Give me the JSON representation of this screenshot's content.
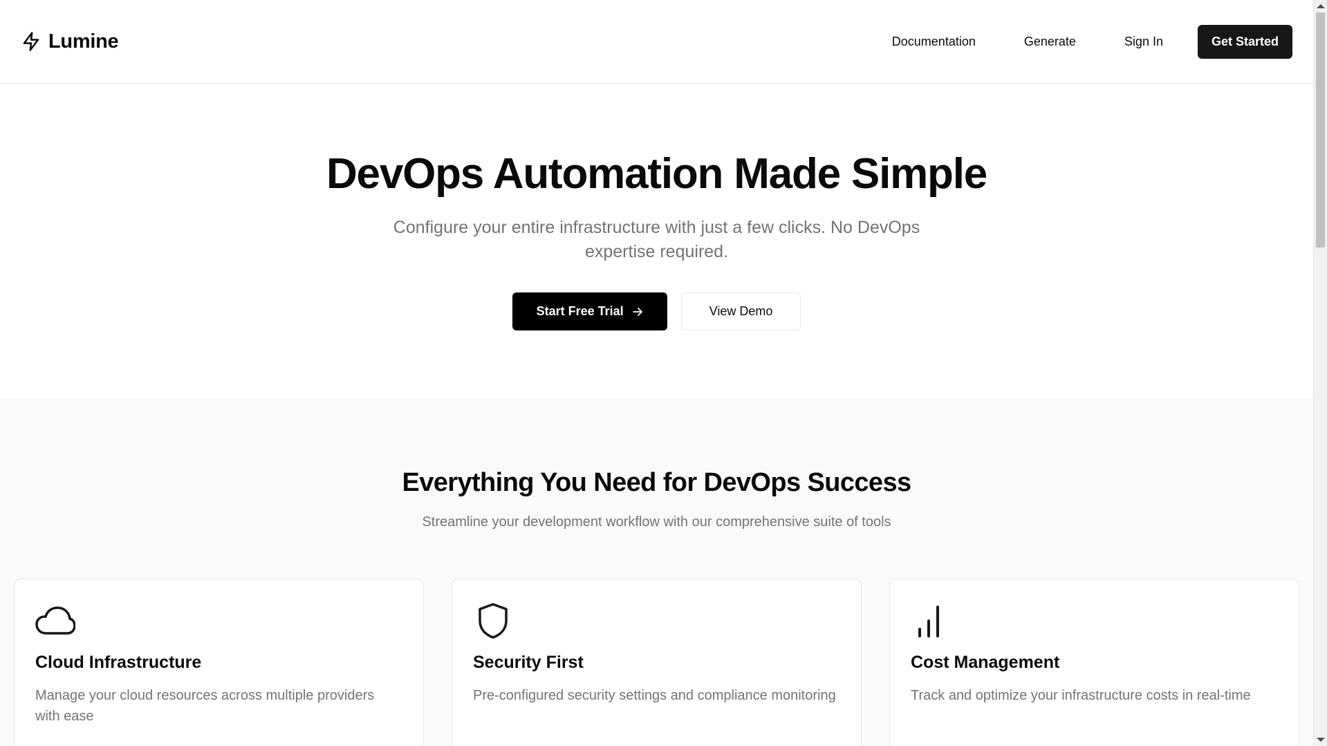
{
  "header": {
    "brand": "Lumine",
    "nav": {
      "documentation": "Documentation",
      "generate": "Generate",
      "sign_in": "Sign In",
      "get_started": "Get Started"
    }
  },
  "hero": {
    "title": "DevOps Automation Made Simple",
    "subtitle": "Configure your entire infrastructure with just a few clicks. No DevOps expertise required.",
    "primary_cta": "Start Free Trial",
    "secondary_cta": "View Demo"
  },
  "features": {
    "title": "Everything You Need for DevOps Success",
    "subtitle": "Streamline your development workflow with our comprehensive suite of tools",
    "cards": [
      {
        "icon": "cloud-icon",
        "title": "Cloud Infrastructure",
        "description": "Manage your cloud resources across multiple providers with ease"
      },
      {
        "icon": "shield-icon",
        "title": "Security First",
        "description": "Pre-configured security settings and compliance monitoring"
      },
      {
        "icon": "bar-chart-icon",
        "title": "Cost Management",
        "description": "Track and optimize your infrastructure costs in real-time"
      }
    ]
  },
  "colors": {
    "text": "#0a0a0a",
    "muted": "#737373",
    "border": "#e5e5e5",
    "section_bg": "#fafafa",
    "button_dark": "#171717"
  }
}
